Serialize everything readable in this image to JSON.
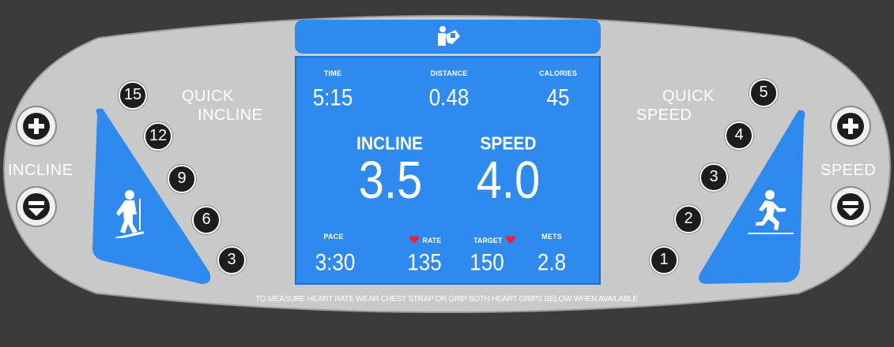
{
  "colors": {
    "background": "#3b3b3b",
    "panel": "#c9c9c9",
    "screen": "#2f8af0",
    "button_dark": "#1d1d1d",
    "heart": "#e8232f"
  },
  "header": {
    "icon": "runner-reading-icon"
  },
  "left": {
    "incline_label": "INCLINE",
    "quick_label_1": "QUICK",
    "quick_label_2": "INCLINE",
    "quick_buttons": [
      "15",
      "12",
      "9",
      "6",
      "3"
    ],
    "plus_icon": "plus-icon",
    "minus_icon": "minus-icon",
    "figure_icon": "hiker-icon"
  },
  "right": {
    "speed_label": "SPEED",
    "quick_label_1": "QUICK",
    "quick_label_2": "SPEED",
    "quick_buttons": [
      "5",
      "4",
      "3",
      "2",
      "1"
    ],
    "plus_icon": "plus-icon",
    "minus_icon": "minus-icon",
    "figure_icon": "runner-icon"
  },
  "display": {
    "time_label": "TIME",
    "time_value": "5:15",
    "distance_label": "DISTANCE",
    "distance_value": "0.48",
    "calories_label": "CALORIES",
    "calories_value": "45",
    "incline_label": "INCLINE",
    "incline_value": "3.5",
    "speed_label": "SPEED",
    "speed_value": "4.0",
    "pace_label": "PACE",
    "pace_value": "3:30",
    "rate_label": "RATE",
    "rate_value": "135",
    "target_label": "TARGET",
    "target_value": "150",
    "mets_label": "METS",
    "mets_value": "2.8"
  },
  "footer_note": "TO MEASURE HEART RATE WEAR CHEST STRAP OR GRIP BOTH HEART GRIPS BELOW WHEN AVAILABLE"
}
